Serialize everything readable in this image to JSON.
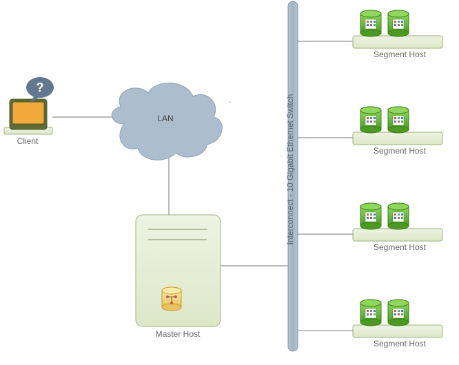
{
  "client": {
    "label": "Client"
  },
  "lan": {
    "label": "LAN"
  },
  "master": {
    "label": "Master Host"
  },
  "switch": {
    "label": "Interconnect - 10 Gigabit Ethernet Switch"
  },
  "segments": [
    {
      "label": "Segment Host"
    },
    {
      "label": "Segment Host"
    },
    {
      "label": "Segment Host"
    },
    {
      "label": "Segment Host"
    }
  ],
  "colors": {
    "platform_fill": "#E6EDD6",
    "platform_stroke": "#9CB176",
    "monitor_fill": "#F2A93B",
    "monitor_stroke": "#6B7A3D",
    "monitor_dark": "#5F6B35",
    "speech_fill": "#61788F",
    "cloud_fill": "#ACBECD",
    "cloud_stroke": "#8AA0B3",
    "switch_fill": "#A7B9C8",
    "switch_stroke": "#7C94A9",
    "server_fill": "#E6EDD6",
    "server_stroke": "#9FB07A",
    "db_green": "#5DAF2A",
    "db_green_dark": "#3E7E1B",
    "db_yellow": "#F2D377",
    "db_yellow_stroke": "#C99A2E",
    "line": "#777"
  }
}
